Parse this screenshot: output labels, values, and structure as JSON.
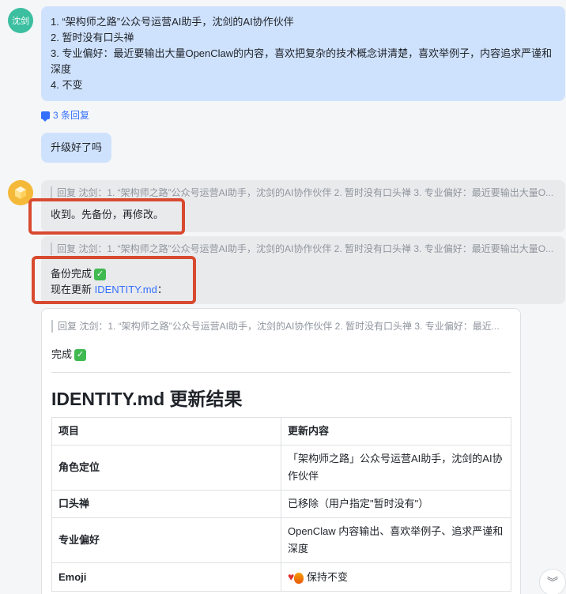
{
  "user": {
    "avatar_text": "沈剑"
  },
  "messages": {
    "user_block": [
      "1. “架构师之路”公众号运营AI助手，沈剑的AI协作伙伴",
      "2. 暂时没有口头禅",
      "3. 专业偏好：最近要输出大量OpenClaw的内容，喜欢把复杂的技术概念讲清楚，喜欢举例子，内容追求严谨和深度",
      "4. 不变"
    ],
    "reply_count": "3 条回复",
    "user_short": "升级好了吗",
    "quote_line": "回复 沈剑：1. “架构师之路”公众号运营AI助手，沈剑的AI协作伙伴 2. 暂时没有口头禅 3. 专业偏好：最近要输出大量O...",
    "bot_reply_1": "收到。先备份，再修改。",
    "bot_reply_2_line1": "备份完成",
    "bot_reply_2_prefix": "现在更新 ",
    "bot_reply_2_link": "IDENTITY.md",
    "bot_reply_2_suffix": "：",
    "card_quote": "回复 沈剑：1. “架构师之路”公众号运营AI助手，沈剑的AI协作伙伴 2. 暂时没有口头禅 3. 专业偏好：最近...",
    "card_done": "完成"
  },
  "result_card": {
    "title": "IDENTITY.md 更新结果",
    "headers": [
      "项目",
      "更新内容"
    ],
    "rows": [
      {
        "key": "角色定位",
        "value": "「架构师之路」公众号运营AI助手，沈剑的AI协作伙伴"
      },
      {
        "key": "口头禅",
        "value": "已移除（用户指定\"暂时没有\"）"
      },
      {
        "key": "专业偏好",
        "value": "OpenClaw 内容输出、喜欢举例子、追求严谨和深度"
      },
      {
        "key": "Emoji",
        "value": "保持不变"
      }
    ]
  },
  "colors": {
    "accent": "#3370ff",
    "highlight": "#d84a30"
  },
  "icons": {
    "reply": "comment-icon",
    "check": "check-mark-icon",
    "scroll": "chevron-double-down-icon"
  }
}
